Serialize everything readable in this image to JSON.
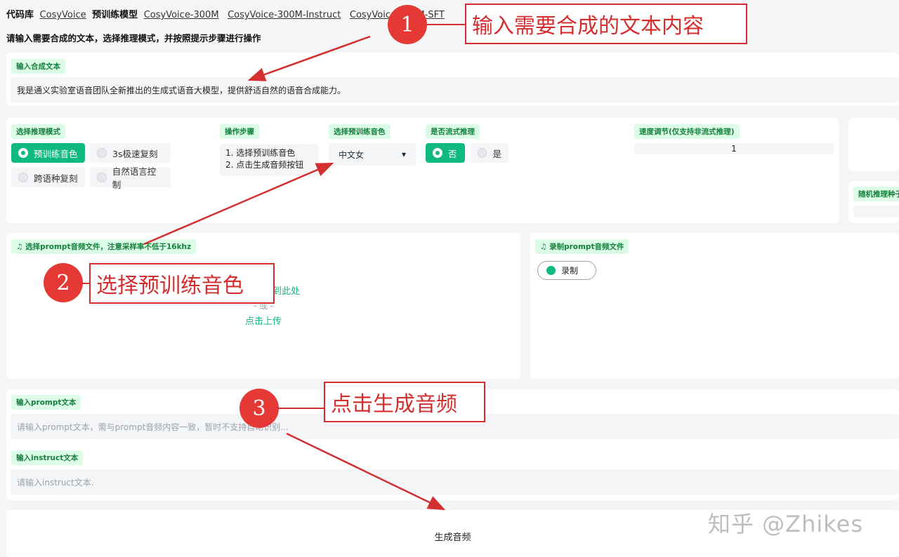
{
  "header": {
    "repo_label": "代码库",
    "repo_link": "CosyVoice",
    "models_label": "预训练模型",
    "model_links": [
      "CosyVoice-300M",
      "CosyVoice-300M-Instruct",
      "CosyVoice-300M-SFT"
    ],
    "subtitle": "请输入需要合成的文本，选择推理模式，并按照提示步骤进行操作"
  },
  "tts_text": {
    "label": "输入合成文本",
    "value": "我是通义实验室语音团队全新推出的生成式语音大模型，提供舒适自然的语音合成能力。"
  },
  "mode": {
    "label": "选择推理模式",
    "options": [
      "预训练音色",
      "3s极速复刻",
      "跨语种复刻",
      "自然语言控制"
    ],
    "selected": "预训练音色"
  },
  "steps": {
    "label": "操作步骤",
    "lines": [
      "1. 选择预训练音色",
      "2. 点击生成音频按钮"
    ]
  },
  "speaker": {
    "label": "选择预训练音色",
    "value": "中文女",
    "caret": "▾"
  },
  "stream": {
    "label": "是否流式推理",
    "options": [
      "否",
      "是"
    ],
    "selected": "否"
  },
  "speed": {
    "label": "速度调节(仅支持非流式推理)",
    "value": "1"
  },
  "seed": {
    "label": "随机推理种子"
  },
  "prompt_upload": {
    "label": "选择prompt音频文件，注意采样率不低于16khz",
    "drop_text": "将音频拖放到此处",
    "or_text": "- 或 -",
    "click_text": "点击上传"
  },
  "prompt_record": {
    "label": "录制prompt音频文件",
    "button": "录制"
  },
  "prompt_text": {
    "label": "输入prompt文本",
    "placeholder": "请输入prompt文本，需与prompt音频内容一致，暂时不支持自动识别..."
  },
  "instruct_text": {
    "label": "输入instruct文本",
    "placeholder": "请输入instruct文本."
  },
  "generate": {
    "label": "生成音频"
  },
  "annotations": [
    {
      "number": "1",
      "text": "输入需要合成的文本内容"
    },
    {
      "number": "2",
      "text": "选择预训练音色"
    },
    {
      "number": "3",
      "text": "点击生成音频"
    }
  ],
  "watermark": "知乎 @Zhikes",
  "colors": {
    "accent": "#10b981",
    "tag_bg": "#dcfce7",
    "tag_text": "#15803d",
    "annotation_red": "#e53935"
  }
}
